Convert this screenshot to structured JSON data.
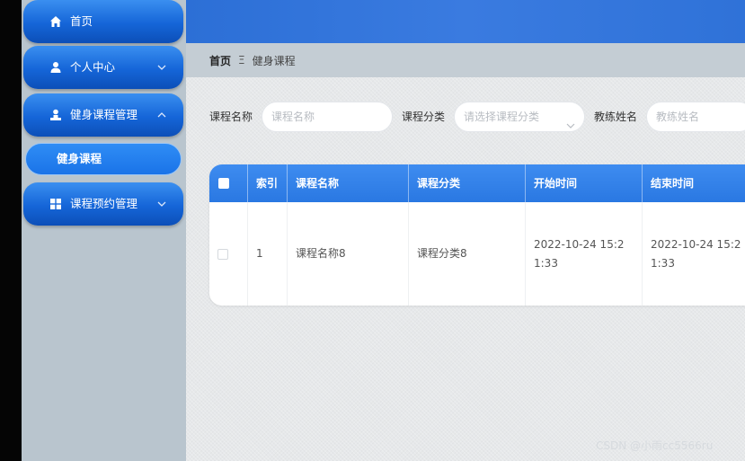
{
  "sidebar": {
    "items": [
      {
        "label": "首页",
        "icon": "home-icon",
        "has_chevron": false
      },
      {
        "label": "个人中心",
        "icon": "user-icon",
        "has_chevron": true,
        "chevron": "down"
      },
      {
        "label": "健身课程管理",
        "icon": "person-icon",
        "has_chevron": true,
        "chevron": "up"
      },
      {
        "label": "课程预约管理",
        "icon": "grid-icon",
        "has_chevron": true,
        "chevron": "down"
      }
    ],
    "sub_items": [
      {
        "label": "健身课程"
      }
    ]
  },
  "breadcrumb": {
    "home": "首页",
    "separator": "Ξ",
    "current": "健身课程"
  },
  "search": {
    "course_name_label": "课程名称",
    "course_name_placeholder": "课程名称",
    "category_label": "课程分类",
    "category_placeholder": "请选择课程分类",
    "coach_label": "教练姓名",
    "coach_placeholder": "教练姓名"
  },
  "table": {
    "columns": [
      "",
      "索引",
      "课程名称",
      "课程分类",
      "开始时间",
      "结束时间"
    ],
    "rows": [
      {
        "index": "1",
        "name": "课程名称8",
        "category": "课程分类8",
        "start": "2022-10-24 15:21:33",
        "end": "2022-10-24 15:21:33"
      }
    ]
  },
  "watermark": "CSDN @小雨cc5566ru",
  "colors": {
    "accent": "#1a6fe0",
    "sidebar_bg": "#b9c5ce",
    "topbar": "#2f72d8"
  }
}
